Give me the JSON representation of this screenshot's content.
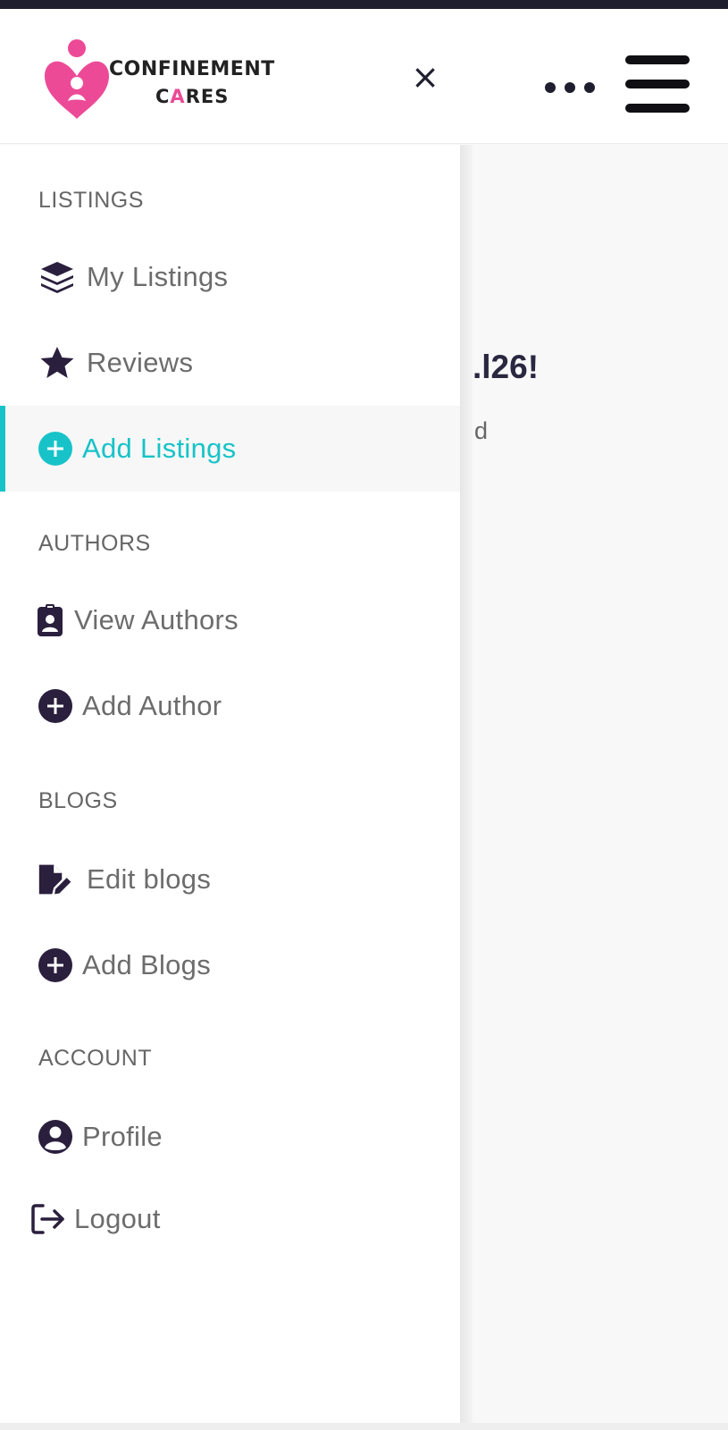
{
  "header": {
    "logo": {
      "line1": "CONFINEMENT",
      "line2_a": "C",
      "line2_pink": "A",
      "line2_b": "RES"
    },
    "close_glyph": "×",
    "more_icon": "ellipsis-icon",
    "menu_icon": "hamburger-icon"
  },
  "main": {
    "title": ".l26!",
    "subtitle": "d"
  },
  "sidebar": {
    "sections": [
      {
        "title": "LISTINGS"
      },
      {
        "title": "AUTHORS"
      },
      {
        "title": "BLOGS"
      },
      {
        "title": "ACCOUNT"
      }
    ],
    "items": [
      {
        "label": "My Listings",
        "icon": "layers-icon"
      },
      {
        "label": "Reviews",
        "icon": "star-icon"
      },
      {
        "label": "Add Listings",
        "icon": "plus-circle-icon",
        "active": true
      },
      {
        "label": "View Authors",
        "icon": "id-badge-icon"
      },
      {
        "label": "Add Author",
        "icon": "plus-circle-icon"
      },
      {
        "label": "Edit blogs",
        "icon": "file-edit-icon"
      },
      {
        "label": "Add Blogs",
        "icon": "plus-circle-icon"
      },
      {
        "label": "Profile",
        "icon": "user-circle-icon"
      },
      {
        "label": "Logout",
        "icon": "logout-icon"
      }
    ]
  },
  "colors": {
    "accent": "#17c3c8",
    "brand_pink": "#ec4a97",
    "icon_dark": "#2a1f3d",
    "text_muted": "#6c6c6c"
  }
}
